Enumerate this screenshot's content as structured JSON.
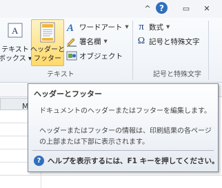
{
  "window": {
    "minimize_glyph": "^",
    "help_glyph": "?",
    "restore_glyph": "▭",
    "close_glyph": "✕"
  },
  "ribbon": {
    "textbox_label_1": "テキスト",
    "textbox_label_2": "ボックス",
    "textbox_dropdown": "▾",
    "header_footer_label_1": "ヘッダーと",
    "header_footer_label_2": "フッター",
    "wordart_label": "ワードアート",
    "wordart_dropdown": "▾",
    "signature_label": "署名欄",
    "signature_dropdown": "▾",
    "object_label": "オブジェクト",
    "group_text_label": "テキスト",
    "equation_label": "数式",
    "equation_dropdown": "▾",
    "symbol_label": "記号と特殊文字",
    "group_symbols_label": "記号と特殊文字",
    "pi_glyph": "π",
    "omega_glyph": "Ω"
  },
  "sheet": {
    "column_letter": "M"
  },
  "tooltip": {
    "title": "ヘッダーとフッター",
    "description": "ドキュメントのヘッダーまたはフッターを編集します。",
    "info": "ヘッダーまたはフッターの情報は、印刷結果の各ページの上部または下部に表示されます。",
    "help_glyph": "?",
    "help_text": "ヘルプを表示するには、F1 キーを押してください。"
  },
  "colors": {
    "accent_blue": "#2f6fbd",
    "highlight": "#ffd96b"
  }
}
